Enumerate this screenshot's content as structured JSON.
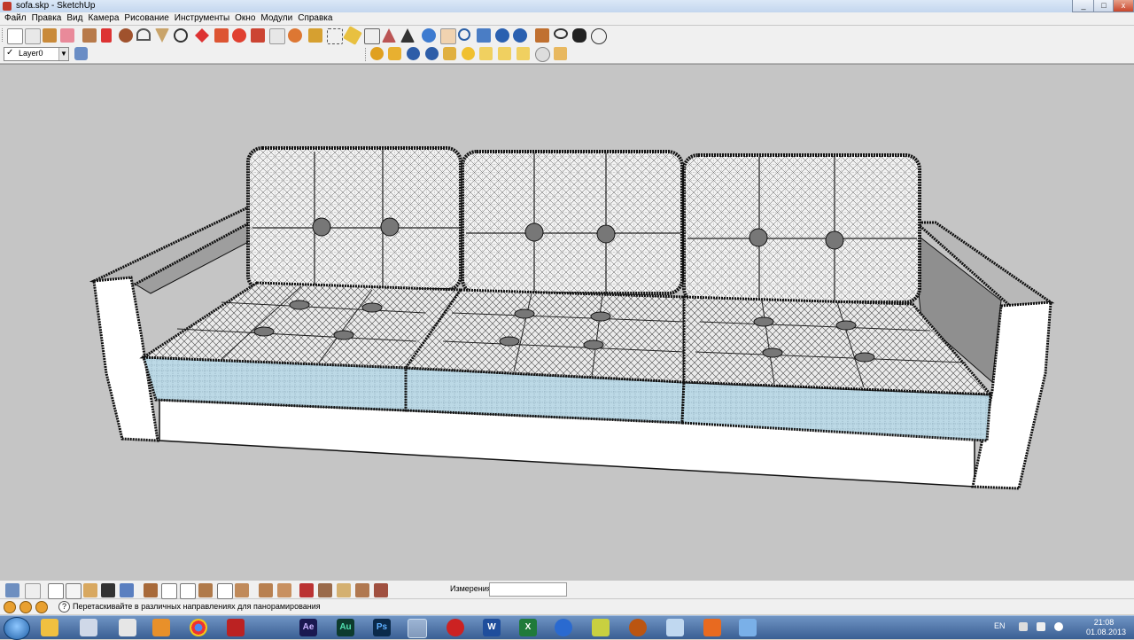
{
  "window": {
    "title": "sofa.skp - SketchUp",
    "minimize_icon": "minimize-icon",
    "maximize_icon": "maximize-icon",
    "close_icon": "close-icon"
  },
  "menu": [
    "Файл",
    "Правка",
    "Вид",
    "Камера",
    "Рисование",
    "Инструменты",
    "Окно",
    "Модули",
    "Справка"
  ],
  "toolbar": {
    "layer_selected": "Layer0",
    "layer_checked": "✓"
  },
  "measurements": {
    "label": "Измерения",
    "value": ""
  },
  "status": {
    "message": "Перетаскивайте в различных направлениях для панорамирования",
    "help": "?"
  },
  "taskbar": {
    "language": "EN",
    "time": "21:08",
    "date": "01.08.2013",
    "apps": [
      "explorer",
      "calculator",
      "media-player",
      "chrome",
      "acrobat",
      "after-effects",
      "audition",
      "photoshop",
      "sketchup",
      "filezilla",
      "word",
      "excel",
      "media",
      "notepad",
      "app-red",
      "outlook",
      "monitor",
      "office",
      "install"
    ],
    "app_labels": {
      "after-effects": "Ae",
      "audition": "Au",
      "photoshop": "Ps",
      "word": "W",
      "excel": "X"
    }
  },
  "colors": {
    "viewport": "#c5c5c5",
    "cushion_blue": "#bcd9e6",
    "accent": "#3a5f93"
  }
}
